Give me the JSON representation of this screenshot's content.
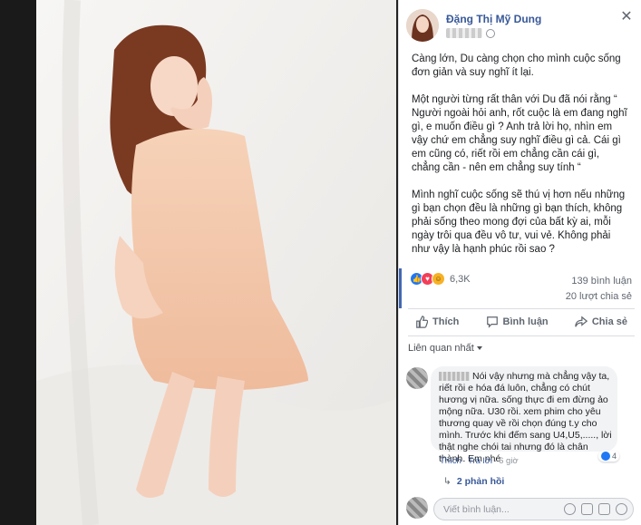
{
  "post": {
    "author": "Đặng Thị Mỹ Dung",
    "paragraphs": [
      "Càng lớn, Du càng chọn cho mình cuộc sống đơn giản và suy nghĩ ít lại.",
      "Một người từng rất thân với Du đã nói rằng “ Người ngoài hỏi anh, rốt cuộc là em đang nghĩ gì, e muốn điều gì ? Anh trả lời họ, nhìn em vậy chứ em chẳng suy nghĩ điều gì cả. Cái gì em cũng có, riết rồi em chẳng cần cái gì, chẳng cần - nên em chẳng suy tính “",
      "Mình nghĩ cuộc sống sẽ thú vị hơn nếu những gì bạn chọn đều là những gì bạn thích, không phải sống theo mong đợi của bất kỳ ai, mỗi ngày trôi qua đều vô tư, vui vẻ. Không phải như vậy là hạnh phúc rồi sao ?"
    ]
  },
  "reactions": {
    "count": "6,3K",
    "comments": "139 bình luận",
    "shares": "20 lượt chia sẻ"
  },
  "actions": {
    "like": "Thích",
    "comment": "Bình luận",
    "share": "Chia sẻ"
  },
  "comments": {
    "sort_label": "Liên quan nhất",
    "items": [
      {
        "text": "Nói vậy nhưng mà chẳng vậy ta, riết rồi e hóa đá luôn, chẳng có chút hương vị nữa. sống thực đi em đừng ảo mộng nữa. U30 rồi. xem phim cho yêu thương quay về rồi chọn đúng t.y cho mình. Trước khi đếm sang U4,U5,....., lời thật nghe chói tai nhưng đó là chân thành. Em nhé",
        "like_label": "Thích",
        "reply_label": "Trả lời",
        "time": "6 giờ",
        "reaction_count": "4",
        "replies_label": "2 phản hồi"
      }
    ],
    "write_placeholder": "Viết bình luận..."
  },
  "colors": {
    "link": "#385898",
    "like_blue": "#2078f4",
    "love_red": "#f33e58",
    "haha_yellow": "#f7b125",
    "dress": "#f4c9ad"
  },
  "icons": [
    "close-icon",
    "globe-icon",
    "like-icon",
    "comment-icon",
    "share-icon",
    "emoji-icon",
    "camera-icon",
    "gif-icon",
    "sticker-icon"
  ]
}
